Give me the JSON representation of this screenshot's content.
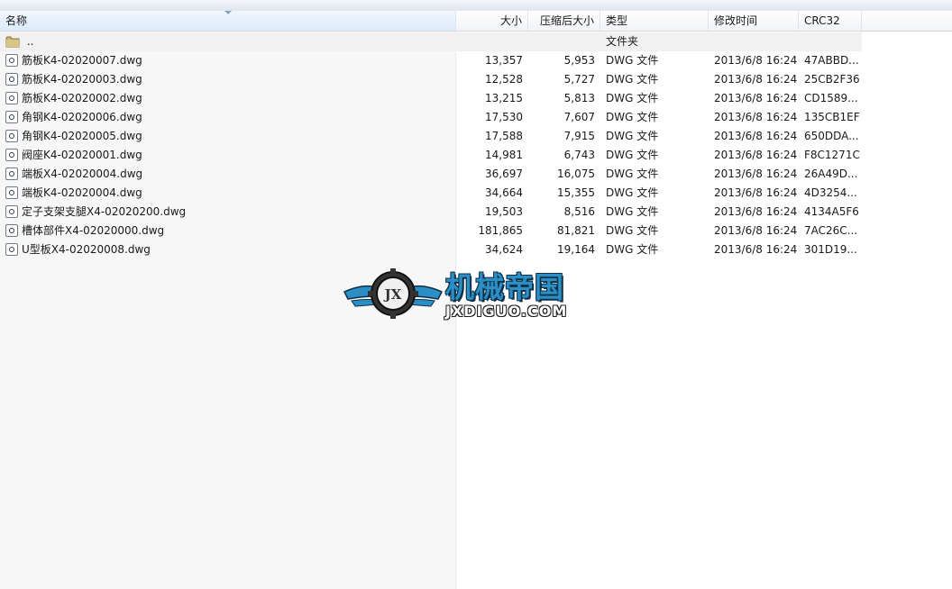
{
  "columns": {
    "name": "名称",
    "size": "大小",
    "packed": "压缩后大小",
    "type": "类型",
    "modified": "修改时间",
    "crc": "CRC32"
  },
  "parent_row": {
    "name": "..",
    "type": "文件夹"
  },
  "files": [
    {
      "name": "筋板K4-02020007.dwg",
      "size": "13,357",
      "packed": "5,953",
      "type": "DWG 文件",
      "modified": "2013/6/8 16:24",
      "crc": "47ABBD..."
    },
    {
      "name": "筋板K4-02020003.dwg",
      "size": "12,528",
      "packed": "5,727",
      "type": "DWG 文件",
      "modified": "2013/6/8 16:24",
      "crc": "25CB2F36"
    },
    {
      "name": "筋板K4-02020002.dwg",
      "size": "13,215",
      "packed": "5,813",
      "type": "DWG 文件",
      "modified": "2013/6/8 16:24",
      "crc": "CD1589..."
    },
    {
      "name": "角钢K4-02020006.dwg",
      "size": "17,530",
      "packed": "7,607",
      "type": "DWG 文件",
      "modified": "2013/6/8 16:24",
      "crc": "135CB1EF"
    },
    {
      "name": "角钢K4-02020005.dwg",
      "size": "17,588",
      "packed": "7,915",
      "type": "DWG 文件",
      "modified": "2013/6/8 16:24",
      "crc": "650DDA..."
    },
    {
      "name": "阀座K4-02020001.dwg",
      "size": "14,981",
      "packed": "6,743",
      "type": "DWG 文件",
      "modified": "2013/6/8 16:24",
      "crc": "F8C1271C"
    },
    {
      "name": "端板X4-02020004.dwg",
      "size": "36,697",
      "packed": "16,075",
      "type": "DWG 文件",
      "modified": "2013/6/8 16:24",
      "crc": "26A49D..."
    },
    {
      "name": "端板K4-02020004.dwg",
      "size": "34,664",
      "packed": "15,355",
      "type": "DWG 文件",
      "modified": "2013/6/8 16:24",
      "crc": "4D3254..."
    },
    {
      "name": "定子支架支腿X4-02020200.dwg",
      "size": "19,503",
      "packed": "8,516",
      "type": "DWG 文件",
      "modified": "2013/6/8 16:24",
      "crc": "4134A5F6"
    },
    {
      "name": "槽体部件X4-02020000.dwg",
      "size": "181,865",
      "packed": "81,821",
      "type": "DWG 文件",
      "modified": "2013/6/8 16:24",
      "crc": "7AC26C..."
    },
    {
      "name": "U型板X4-02020008.dwg",
      "size": "34,624",
      "packed": "19,164",
      "type": "DWG 文件",
      "modified": "2013/6/8 16:24",
      "crc": "301D19..."
    }
  ],
  "watermark": {
    "title": "机械帝国",
    "url": "JXDIGUO.COM",
    "emblem": "JX"
  },
  "colors": {
    "accent": "#2b8ec4",
    "sorted_header": "#dcebfb",
    "folder": "#c9b26a"
  },
  "icons": {
    "file": "dwg-file-icon",
    "folder": "folder-icon"
  }
}
